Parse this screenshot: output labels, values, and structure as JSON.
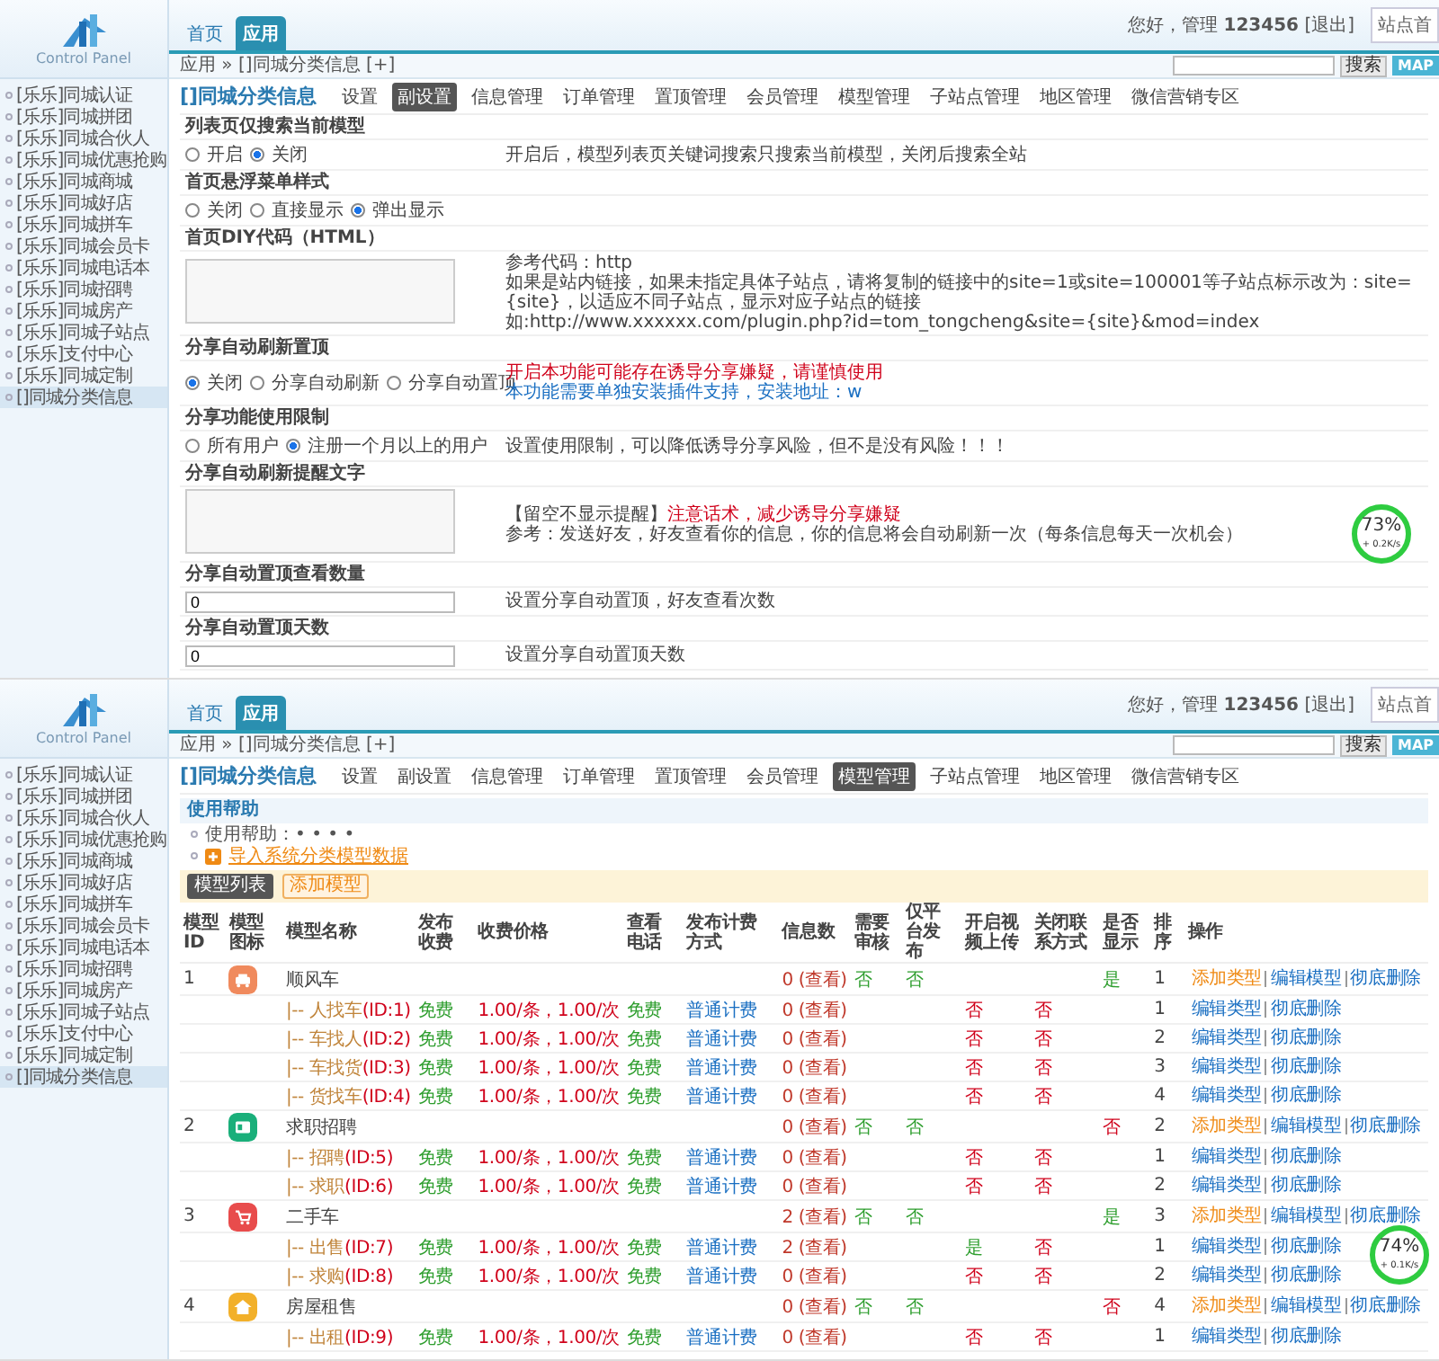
{
  "panels": [
    {
      "header": {
        "logo_text": "Control Panel",
        "nav": [
          {
            "label": "首页",
            "selected": false
          },
          {
            "label": "应用",
            "selected": true
          }
        ],
        "greeting": "您好，管理 **123456** [退出]",
        "home_button": "站点首",
        "breadcrumb": "应用 » []同城分类信息 [+]",
        "search_button": "搜索",
        "map_button": "MAP"
      },
      "sidebar": [
        {
          "label": "[乐乐]同城认证",
          "selected": false
        },
        {
          "label": "[乐乐]同城拼团",
          "selected": false
        },
        {
          "label": "[乐乐]同城合伙人",
          "selected": false
        },
        {
          "label": "[乐乐]同城优惠抢购",
          "selected": false
        },
        {
          "label": "[乐乐]同城商城",
          "selected": false
        },
        {
          "label": "[乐乐]同城好店",
          "selected": false
        },
        {
          "label": "[乐乐]同城拼车",
          "selected": false
        },
        {
          "label": "[乐乐]同城会员卡",
          "selected": false
        },
        {
          "label": "[乐乐]同城电话本",
          "selected": false
        },
        {
          "label": "[乐乐]同城招聘",
          "selected": false
        },
        {
          "label": "[乐乐]同城房产",
          "selected": false
        },
        {
          "label": "[乐乐]同城子站点",
          "selected": false
        },
        {
          "label": "[乐乐]支付中心",
          "selected": false
        },
        {
          "label": "[乐乐]同城定制",
          "selected": false
        },
        {
          "label": "[]同城分类信息",
          "selected": true
        }
      ],
      "module_title": "[]同城分类信息",
      "tabs": [
        {
          "label": "设置",
          "selected": false
        },
        {
          "label": "副设置",
          "selected": true
        },
        {
          "label": "信息管理",
          "selected": false
        },
        {
          "label": "订单管理",
          "selected": false
        },
        {
          "label": "置顶管理",
          "selected": false
        },
        {
          "label": "会员管理",
          "selected": false
        },
        {
          "label": "模型管理",
          "selected": false
        },
        {
          "label": "子站点管理",
          "selected": false
        },
        {
          "label": "地区管理",
          "selected": false
        },
        {
          "label": "微信营销专区",
          "selected": false
        }
      ],
      "content": {
        "kind": "settings",
        "sections": [
          {
            "title": "列表页仅搜索当前模型",
            "kind": "radio",
            "options": [
              {
                "label": "开启",
                "selected": false
              },
              {
                "label": "关闭",
                "selected": true
              }
            ],
            "notes": [
              [
                {
                  "text": "开启后，模型列表页关键词搜索只搜索当前模型，关闭后搜索全站",
                  "color": "#444444"
                }
              ]
            ]
          },
          {
            "title": "首页悬浮菜单样式",
            "kind": "radio",
            "options": [
              {
                "label": "关闭",
                "selected": false
              },
              {
                "label": "直接显示",
                "selected": false
              },
              {
                "label": "弹出显示",
                "selected": true
              }
            ]
          },
          {
            "title": "首页DIY代码（HTML）",
            "kind": "textarea",
            "notes": [
              [
                {
                  "text": "参考代码：http",
                  "color": "#444444"
                }
              ],
              [
                {
                  "text": "如果是站内链接，如果未指定具体子站点，请将复制的链接中的site=1或site=100001等子站点标示改为：site={site}，以适应不同子站点，显示对应子站点的链接",
                  "color": "#444444"
                }
              ],
              [
                {
                  "text": "如:http://www.xxxxxx.com/plugin.php?id=tom_tongcheng&site={site}&mod=index",
                  "color": "#444444"
                }
              ]
            ]
          },
          {
            "title": "分享自动刷新置顶",
            "kind": "radio",
            "options": [
              {
                "label": "关闭",
                "selected": true
              },
              {
                "label": "分享自动刷新",
                "selected": false
              },
              {
                "label": "分享自动置顶",
                "selected": false
              }
            ],
            "notes": [
              [
                {
                  "text": "开启本功能可能存在诱导分享嫌疑，请谨慎使用",
                  "color": "#d0021b"
                }
              ],
              [
                {
                  "text": "本功能需要单独安装插件支持，安装地址：w",
                  "color": "#1a6fc2"
                }
              ]
            ]
          },
          {
            "title": "分享功能使用限制",
            "kind": "radio",
            "options": [
              {
                "label": "所有用户",
                "selected": false
              },
              {
                "label": "注册一个月以上的用户",
                "selected": true
              }
            ],
            "notes": [
              [
                {
                  "text": "设置使用限制，可以降低诱导分享风险，但不是没有风险！！！",
                  "color": "#444444"
                }
              ]
            ]
          },
          {
            "title": "分享自动刷新提醒文字",
            "kind": "textarea",
            "notes": [
              [
                {
                  "text": "【留空不显示提醒】",
                  "color": "#444444"
                },
                {
                  "text": "注意话术，减少诱导分享嫌疑",
                  "color": "#d0021b"
                }
              ],
              [
                {
                  "text": "参考：发送好友，好友查看你的信息，你的信息将会自动刷新一次（每条信息每天一次机会）",
                  "color": "#444444"
                }
              ]
            ]
          },
          {
            "title": "分享自动置顶查看数量",
            "kind": "input",
            "value": "0",
            "notes": [
              [
                {
                  "text": "设置分享自动置顶，好友查看次数",
                  "color": "#444444"
                }
              ]
            ]
          },
          {
            "title": "分享自动置顶天数",
            "kind": "input",
            "value": "0",
            "notes": [
              [
                {
                  "text": "设置分享自动置顶天数",
                  "color": "#444444"
                }
              ]
            ]
          }
        ]
      },
      "speed_widget": {
        "percent": "73%",
        "rate": "+ 0.2K/s"
      }
    },
    {
      "header": {
        "logo_text": "Control Panel",
        "nav": [
          {
            "label": "首页",
            "selected": false
          },
          {
            "label": "应用",
            "selected": true
          }
        ],
        "greeting": "您好，管理 **123456** [退出]",
        "home_button": "站点首",
        "breadcrumb": "应用 » []同城分类信息 [+]",
        "search_button": "搜索",
        "map_button": "MAP"
      },
      "sidebar": [
        {
          "label": "[乐乐]同城认证",
          "selected": false
        },
        {
          "label": "[乐乐]同城拼团",
          "selected": false
        },
        {
          "label": "[乐乐]同城合伙人",
          "selected": false
        },
        {
          "label": "[乐乐]同城优惠抢购",
          "selected": false
        },
        {
          "label": "[乐乐]同城商城",
          "selected": false
        },
        {
          "label": "[乐乐]同城好店",
          "selected": false
        },
        {
          "label": "[乐乐]同城拼车",
          "selected": false
        },
        {
          "label": "[乐乐]同城会员卡",
          "selected": false
        },
        {
          "label": "[乐乐]同城电话本",
          "selected": false
        },
        {
          "label": "[乐乐]同城招聘",
          "selected": false
        },
        {
          "label": "[乐乐]同城房产",
          "selected": false
        },
        {
          "label": "[乐乐]同城子站点",
          "selected": false
        },
        {
          "label": "[乐乐]支付中心",
          "selected": false
        },
        {
          "label": "[乐乐]同城定制",
          "selected": false
        },
        {
          "label": "[]同城分类信息",
          "selected": true
        }
      ],
      "module_title": "[]同城分类信息",
      "tabs": [
        {
          "label": "设置",
          "selected": false
        },
        {
          "label": "副设置",
          "selected": false
        },
        {
          "label": "信息管理",
          "selected": false
        },
        {
          "label": "订单管理",
          "selected": false
        },
        {
          "label": "置顶管理",
          "selected": false
        },
        {
          "label": "会员管理",
          "selected": false
        },
        {
          "label": "模型管理",
          "selected": true
        },
        {
          "label": "子站点管理",
          "selected": false
        },
        {
          "label": "地区管理",
          "selected": false
        },
        {
          "label": "微信营销专区",
          "selected": false
        }
      ],
      "content": {
        "kind": "models",
        "help_title": "使用帮助",
        "help_lines": [
          "使用帮助：• • • •"
        ],
        "import_link": "导入系统分类模型数据",
        "toolbar": [
          {
            "label": "模型列表",
            "selected": true
          },
          {
            "label": "添加模型",
            "selected": false
          }
        ],
        "columns": [
          "模型ID",
          "模型图标",
          "模型名称",
          "发布收费",
          "收费价格",
          "查看电话",
          "发布计费方式",
          "信息数",
          "需要审核",
          "仅平台发布",
          "开启视频上传",
          "关闭联系方式",
          "是否显示",
          "排序",
          "操作"
        ],
        "rows": [
          {
            "kind": "model",
            "id": "1",
            "color": "#f08a5d",
            "name": "顺风车",
            "count": "0 (查看)",
            "review": {
              "text": "否",
              "color": "#2e9e2e"
            },
            "platform_only": {
              "text": "否",
              "color": "#2e9e2e"
            },
            "show": {
              "text": "是",
              "color": "#2e9e2e"
            },
            "sort": "1",
            "actions": [
              {
                "text": "添加类型",
                "color": "#ef8a14"
              },
              {
                "text": "编辑模型",
                "color": "#1a6fc2"
              },
              {
                "text": "彻底删除",
                "color": "#1a6fc2"
              }
            ]
          },
          {
            "kind": "type",
            "prefix": "|-- ",
            "name": "人找车",
            "type_id": "(ID:1)",
            "fee": "免费",
            "price": "1.00/条，1.00/次",
            "phone": "免费",
            "billing": "普通计费",
            "count": "0 (查看)",
            "video": {
              "text": "否",
              "color": "#d0021b"
            },
            "close_contact": {
              "text": "否",
              "color": "#d0021b"
            },
            "sort": "1",
            "actions": [
              {
                "text": "编辑类型",
                "color": "#1a6fc2"
              },
              {
                "text": "彻底删除",
                "color": "#1a6fc2"
              }
            ]
          },
          {
            "kind": "type",
            "prefix": "|-- ",
            "name": "车找人",
            "type_id": "(ID:2)",
            "fee": "免费",
            "price": "1.00/条，1.00/次",
            "phone": "免费",
            "billing": "普通计费",
            "count": "0 (查看)",
            "video": {
              "text": "否",
              "color": "#d0021b"
            },
            "close_contact": {
              "text": "否",
              "color": "#d0021b"
            },
            "sort": "2",
            "actions": [
              {
                "text": "编辑类型",
                "color": "#1a6fc2"
              },
              {
                "text": "彻底删除",
                "color": "#1a6fc2"
              }
            ]
          },
          {
            "kind": "type",
            "prefix": "|-- ",
            "name": "车找货",
            "type_id": "(ID:3)",
            "fee": "免费",
            "price": "1.00/条，1.00/次",
            "phone": "免费",
            "billing": "普通计费",
            "count": "0 (查看)",
            "video": {
              "text": "否",
              "color": "#d0021b"
            },
            "close_contact": {
              "text": "否",
              "color": "#d0021b"
            },
            "sort": "3",
            "actions": [
              {
                "text": "编辑类型",
                "color": "#1a6fc2"
              },
              {
                "text": "彻底删除",
                "color": "#1a6fc2"
              }
            ]
          },
          {
            "kind": "type",
            "prefix": "|-- ",
            "name": "货找车",
            "type_id": "(ID:4)",
            "fee": "免费",
            "price": "1.00/条，1.00/次",
            "phone": "免费",
            "billing": "普通计费",
            "count": "0 (查看)",
            "video": {
              "text": "否",
              "color": "#d0021b"
            },
            "close_contact": {
              "text": "否",
              "color": "#d0021b"
            },
            "sort": "4",
            "actions": [
              {
                "text": "编辑类型",
                "color": "#1a6fc2"
              },
              {
                "text": "彻底删除",
                "color": "#1a6fc2"
              }
            ]
          },
          {
            "kind": "model",
            "id": "2",
            "color": "#1aaf7a",
            "name": "求职招聘",
            "count": "0 (查看)",
            "review": {
              "text": "否",
              "color": "#2e9e2e"
            },
            "platform_only": {
              "text": "否",
              "color": "#2e9e2e"
            },
            "show": {
              "text": "否",
              "color": "#d0021b"
            },
            "sort": "2",
            "actions": [
              {
                "text": "添加类型",
                "color": "#ef8a14"
              },
              {
                "text": "编辑模型",
                "color": "#1a6fc2"
              },
              {
                "text": "彻底删除",
                "color": "#1a6fc2"
              }
            ]
          },
          {
            "kind": "type",
            "prefix": "|-- ",
            "name": "招聘",
            "type_id": "(ID:5)",
            "fee": "免费",
            "price": "1.00/条，1.00/次",
            "phone": "免费",
            "billing": "普通计费",
            "count": "0 (查看)",
            "video": {
              "text": "否",
              "color": "#d0021b"
            },
            "close_contact": {
              "text": "否",
              "color": "#d0021b"
            },
            "sort": "1",
            "actions": [
              {
                "text": "编辑类型",
                "color": "#1a6fc2"
              },
              {
                "text": "彻底删除",
                "color": "#1a6fc2"
              }
            ]
          },
          {
            "kind": "type",
            "prefix": "|-- ",
            "name": "求职",
            "type_id": "(ID:6)",
            "fee": "免费",
            "price": "1.00/条，1.00/次",
            "phone": "免费",
            "billing": "普通计费",
            "count": "0 (查看)",
            "video": {
              "text": "否",
              "color": "#d0021b"
            },
            "close_contact": {
              "text": "否",
              "color": "#d0021b"
            },
            "sort": "2",
            "actions": [
              {
                "text": "编辑类型",
                "color": "#1a6fc2"
              },
              {
                "text": "彻底删除",
                "color": "#1a6fc2"
              }
            ]
          },
          {
            "kind": "model",
            "id": "3",
            "color": "#e84c4c",
            "name": "二手车",
            "count": "2 (查看)",
            "review": {
              "text": "否",
              "color": "#2e9e2e"
            },
            "platform_only": {
              "text": "否",
              "color": "#2e9e2e"
            },
            "show": {
              "text": "是",
              "color": "#2e9e2e"
            },
            "sort": "3",
            "actions": [
              {
                "text": "添加类型",
                "color": "#ef8a14"
              },
              {
                "text": "编辑模型",
                "color": "#1a6fc2"
              },
              {
                "text": "彻底删除",
                "color": "#1a6fc2"
              }
            ]
          },
          {
            "kind": "type",
            "prefix": "|-- ",
            "name": "出售",
            "type_id": "(ID:7)",
            "fee": "免费",
            "price": "1.00/条，1.00/次",
            "phone": "免费",
            "billing": "普通计费",
            "count": "2 (查看)",
            "video": {
              "text": "是",
              "color": "#2e9e2e"
            },
            "close_contact": {
              "text": "否",
              "color": "#d0021b"
            },
            "sort": "1",
            "actions": [
              {
                "text": "编辑类型",
                "color": "#1a6fc2"
              },
              {
                "text": "彻底删除",
                "color": "#1a6fc2"
              }
            ]
          },
          {
            "kind": "type",
            "prefix": "|-- ",
            "name": "求购",
            "type_id": "(ID:8)",
            "fee": "免费",
            "price": "1.00/条，1.00/次",
            "phone": "免费",
            "billing": "普通计费",
            "count": "0 (查看)",
            "video": {
              "text": "否",
              "color": "#d0021b"
            },
            "close_contact": {
              "text": "否",
              "color": "#d0021b"
            },
            "sort": "2",
            "actions": [
              {
                "text": "编辑类型",
                "color": "#1a6fc2"
              },
              {
                "text": "彻底删除",
                "color": "#1a6fc2"
              }
            ]
          },
          {
            "kind": "model",
            "id": "4",
            "color": "#f2b02a",
            "name": "房屋租售",
            "count": "0 (查看)",
            "review": {
              "text": "否",
              "color": "#2e9e2e"
            },
            "platform_only": {
              "text": "否",
              "color": "#2e9e2e"
            },
            "show": {
              "text": "否",
              "color": "#d0021b"
            },
            "sort": "4",
            "actions": [
              {
                "text": "添加类型",
                "color": "#ef8a14"
              },
              {
                "text": "编辑模型",
                "color": "#1a6fc2"
              },
              {
                "text": "彻底删除",
                "color": "#1a6fc2"
              }
            ]
          },
          {
            "kind": "type",
            "prefix": "|-- ",
            "name": "出租",
            "type_id": "(ID:9)",
            "fee": "免费",
            "price": "1.00/条，1.00/次",
            "phone": "免费",
            "billing": "普通计费",
            "count": "0 (查看)",
            "video": {
              "text": "否",
              "color": "#d0021b"
            },
            "close_contact": {
              "text": "否",
              "color": "#d0021b"
            },
            "sort": "1",
            "actions": [
              {
                "text": "编辑类型",
                "color": "#1a6fc2"
              },
              {
                "text": "彻底删除",
                "color": "#1a6fc2"
              }
            ]
          }
        ]
      },
      "speed_widget": {
        "percent": "74%",
        "rate": "+ 0.1K/s"
      }
    }
  ]
}
